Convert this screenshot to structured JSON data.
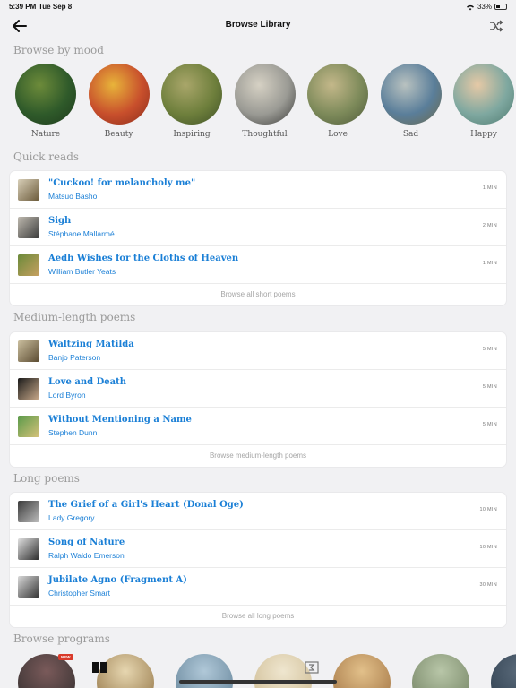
{
  "status_bar": {
    "time": "5:39 PM",
    "date": "Tue Sep 8",
    "battery": "33%"
  },
  "nav": {
    "title": "Browse Library"
  },
  "sections": {
    "mood": "Browse by mood",
    "quick": "Quick reads",
    "medium": "Medium-length poems",
    "long": "Long poems",
    "programs": "Browse programs"
  },
  "moods": [
    {
      "label": "Nature",
      "colors": [
        "#2f5a2a",
        "#6d8b3a",
        "#1e3a1c"
      ]
    },
    {
      "label": "Beauty",
      "colors": [
        "#c84f2c",
        "#e8b43a",
        "#8a2d1c"
      ]
    },
    {
      "label": "Inspiring",
      "colors": [
        "#6e7f3c",
        "#a9a66a",
        "#3d4f26"
      ]
    },
    {
      "label": "Thoughtful",
      "colors": [
        "#9a9a94",
        "#d6d1c4",
        "#3a3a38"
      ]
    },
    {
      "label": "Love",
      "colors": [
        "#7d8a5a",
        "#c4b88a",
        "#4e5a3a"
      ]
    },
    {
      "label": "Sad",
      "colors": [
        "#5a7e9a",
        "#b9c2c0",
        "#6d6a4a"
      ]
    },
    {
      "label": "Happy",
      "colors": [
        "#7fa8a0",
        "#e6c9a6",
        "#4e7a70"
      ]
    }
  ],
  "quick_reads": {
    "items": [
      {
        "title": "\"Cuckoo! for melancholy me\"",
        "author": "Matsuo Basho",
        "duration": "1 MIN",
        "thumb": [
          "#d8cfb8",
          "#6b5a3a"
        ]
      },
      {
        "title": "Sigh",
        "author": "Stéphane Mallarmé",
        "duration": "2 MIN",
        "thumb": [
          "#bfbab0",
          "#3a3a3a"
        ]
      },
      {
        "title": "Aedh Wishes for the Cloths of Heaven",
        "author": "William Butler Yeats",
        "duration": "1 MIN",
        "thumb": [
          "#6a8a3a",
          "#c8a060"
        ]
      }
    ],
    "browse": "Browse all short poems"
  },
  "medium": {
    "items": [
      {
        "title": "Waltzing Matilda",
        "author": "Banjo Paterson",
        "duration": "5 MIN",
        "thumb": [
          "#cbbf9f",
          "#5a4a30"
        ]
      },
      {
        "title": "Love and Death",
        "author": "Lord Byron",
        "duration": "5 MIN",
        "thumb": [
          "#1a1a1a",
          "#c9a98a"
        ]
      },
      {
        "title": "Without Mentioning a Name",
        "author": "Stephen Dunn",
        "duration": "5 MIN",
        "thumb": [
          "#5a9a4a",
          "#d6c27a"
        ]
      }
    ],
    "browse": "Browse medium-length poems"
  },
  "long": {
    "items": [
      {
        "title": "The Grief of a Girl's Heart  (Donal Oge)",
        "author": "Lady Gregory",
        "duration": "10 MIN",
        "thumb": [
          "#3a3a3a",
          "#bdbdbd"
        ]
      },
      {
        "title": "Song of Nature",
        "author": "Ralph Waldo Emerson",
        "duration": "10 MIN",
        "thumb": [
          "#e0e0e0",
          "#2a2a2a"
        ]
      },
      {
        "title": "Jubilate Agno (Fragment A)",
        "author": "Christopher Smart",
        "duration": "30 MIN",
        "thumb": [
          "#d9d9d9",
          "#333333"
        ]
      }
    ],
    "browse": "Browse all long poems"
  },
  "programs": {
    "new_badge": "NEW",
    "items": [
      {
        "colors": [
          "#7a5a5a",
          "#2a2a2a"
        ]
      },
      {
        "colors": [
          "#e6d6b0",
          "#8a6a3a"
        ]
      },
      {
        "colors": [
          "#b0c8d8",
          "#5a7a90"
        ]
      },
      {
        "colors": [
          "#efe6cf",
          "#c9b58a"
        ]
      },
      {
        "colors": [
          "#e2c08a",
          "#9a6a3a"
        ]
      },
      {
        "colors": [
          "#b8c6a8",
          "#6a7a5a"
        ]
      },
      {
        "colors": [
          "#5a6a7a",
          "#2a3a4a"
        ]
      }
    ]
  },
  "colors": {
    "link": "#1a7fd6",
    "background": "#f1f1f3",
    "section_title": "#9a9a9a",
    "badge": "#d93a2a"
  },
  "icons": {
    "back": "arrow-left-icon",
    "shuffle": "shuffle-icon",
    "wifi": "wifi-icon",
    "battery": "battery-icon",
    "library": "library-icon",
    "book": "book-icon"
  }
}
